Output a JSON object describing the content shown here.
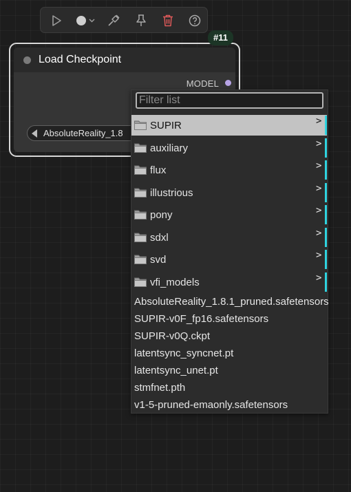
{
  "toolbar": {
    "buttons": [
      {
        "icon": "play-icon"
      },
      {
        "icon": "color-circle-icon"
      },
      {
        "icon": "bypass-icon"
      },
      {
        "icon": "pin-icon"
      },
      {
        "icon": "trash-icon",
        "color": "#e05a5a"
      },
      {
        "icon": "help-icon"
      }
    ]
  },
  "node": {
    "title": "Load Checkpoint",
    "badge": "#11",
    "output_label": "MODEL",
    "output_color": "#b7a4e6",
    "widget_value": "AbsoluteReality_1.8"
  },
  "dropdown": {
    "filter_placeholder": "Filter list",
    "folders": [
      {
        "label": "SUPIR",
        "selected": true
      },
      {
        "label": "auxiliary",
        "selected": false
      },
      {
        "label": "flux",
        "selected": false
      },
      {
        "label": "illustrious",
        "selected": false
      },
      {
        "label": "pony",
        "selected": false
      },
      {
        "label": "sdxl",
        "selected": false
      },
      {
        "label": "svd",
        "selected": false
      },
      {
        "label": "vfi_models",
        "selected": false
      }
    ],
    "chevron": ">",
    "files": [
      "AbsoluteReality_1.8.1_pruned.safetensors",
      "SUPIR-v0F_fp16.safetensors",
      "SUPIR-v0Q.ckpt",
      "latentsync_syncnet.pt",
      "latentsync_unet.pt",
      "stmfnet.pth",
      "v1-5-pruned-emaonly.safetensors"
    ],
    "accent_color": "#2fd4e0"
  }
}
